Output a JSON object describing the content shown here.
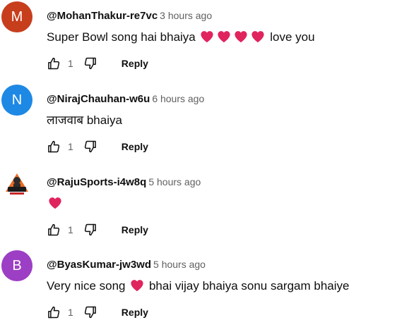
{
  "comments": [
    {
      "avatar_letter": "M",
      "avatar_color": "#c73e1d",
      "author": "@MohanThakur-re7vc",
      "time": "3 hours ago",
      "text_before": "Super Bowl song hai bhaiya ",
      "hearts": 4,
      "text_after": " love you",
      "likes": "1",
      "reply_label": "Reply"
    },
    {
      "avatar_letter": "N",
      "avatar_color": "#1e88e5",
      "author": "@NirajChauhan-w6u",
      "time": "6 hours ago",
      "text_before": "लाजवाब bhaiya",
      "hearts": 0,
      "text_after": "",
      "likes": "1",
      "reply_label": "Reply"
    },
    {
      "avatar_letter": "",
      "avatar_image": "cricket-logo-icon",
      "avatar_color": "#ffffff",
      "author": "@RajuSports-i4w8q",
      "time": "5 hours ago",
      "text_before": "",
      "hearts": 1,
      "text_after": "",
      "likes": "1",
      "reply_label": "Reply"
    },
    {
      "avatar_letter": "B",
      "avatar_color": "#9c3fc4",
      "author": "@ByasKumar-jw3wd",
      "time": "5 hours ago",
      "text_before": "Very nice song ",
      "hearts": 1,
      "text_after": " bhai vijay bhaiya sonu sargam bhaiye",
      "likes": "1",
      "reply_label": "Reply"
    }
  ],
  "icons": {
    "like": "thumbs-up-icon",
    "dislike": "thumbs-down-icon",
    "heart": "red-heart-emoji"
  },
  "colors": {
    "heart": "#e0245e",
    "muted": "#606060"
  }
}
